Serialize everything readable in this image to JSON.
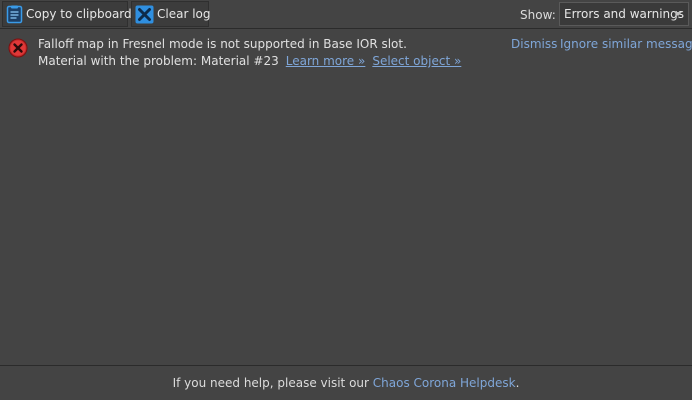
{
  "toolbar": {
    "copy_label": "Copy to clipboard",
    "copy_icon": "clipboard-icon",
    "clear_label": "Clear log",
    "clear_icon": "clear-x-icon",
    "show_label": "Show:",
    "show_value": "Errors and warnings"
  },
  "log": {
    "entries": [
      {
        "severity": "error",
        "icon": "error-icon",
        "line1": "Falloff map in Fresnel mode is not supported in Base IOR slot.",
        "line2": "Material with the problem: Material #23",
        "learn_more": "Learn more »",
        "select_object": "Select object »",
        "dismiss": "Dismiss",
        "ignore": "Ignore similar messages"
      }
    ]
  },
  "footer": {
    "text": "If you need help, please visit our ",
    "link": "Chaos Corona Helpdesk",
    "suffix": "."
  },
  "colors": {
    "background": "#444444",
    "link": "#7fa6d8",
    "error": "#e03030",
    "icon_blue": "#2f8fe0"
  }
}
